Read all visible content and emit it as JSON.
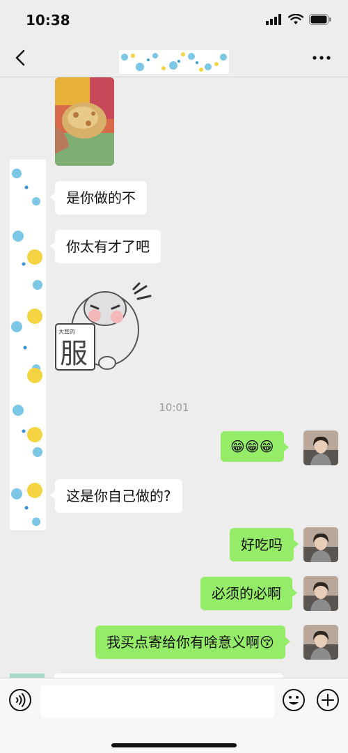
{
  "status": {
    "time": "10:38"
  },
  "colors": {
    "right_bubble": "#95ec69",
    "left_bubble": "#ffffff",
    "background": "#ededed"
  },
  "messages": [
    {
      "side": "left",
      "type": "image",
      "name": "food-photo"
    },
    {
      "side": "left",
      "type": "text",
      "text": "是你做的不"
    },
    {
      "side": "left",
      "type": "text",
      "text": "你太有才了吧"
    },
    {
      "side": "left",
      "type": "sticker",
      "sticker_text": "服",
      "sticker_small_text": "大耳的"
    },
    {
      "type": "timestamp",
      "text": "10:01"
    },
    {
      "side": "right",
      "type": "text",
      "text": "😁😁😁"
    },
    {
      "side": "left",
      "type": "text",
      "text": "这是你自己做的?"
    },
    {
      "side": "right",
      "type": "text",
      "text": "好吃吗"
    },
    {
      "side": "right",
      "type": "text",
      "text": "必须的必啊"
    },
    {
      "side": "right",
      "type": "text",
      "text": "我买点寄给你有啥意义啊😚"
    }
  ],
  "icons": {
    "back": "chevron-left-icon",
    "more": "more-icon",
    "voice": "voice-icon",
    "emoji": "emoji-icon",
    "plus": "plus-icon"
  }
}
